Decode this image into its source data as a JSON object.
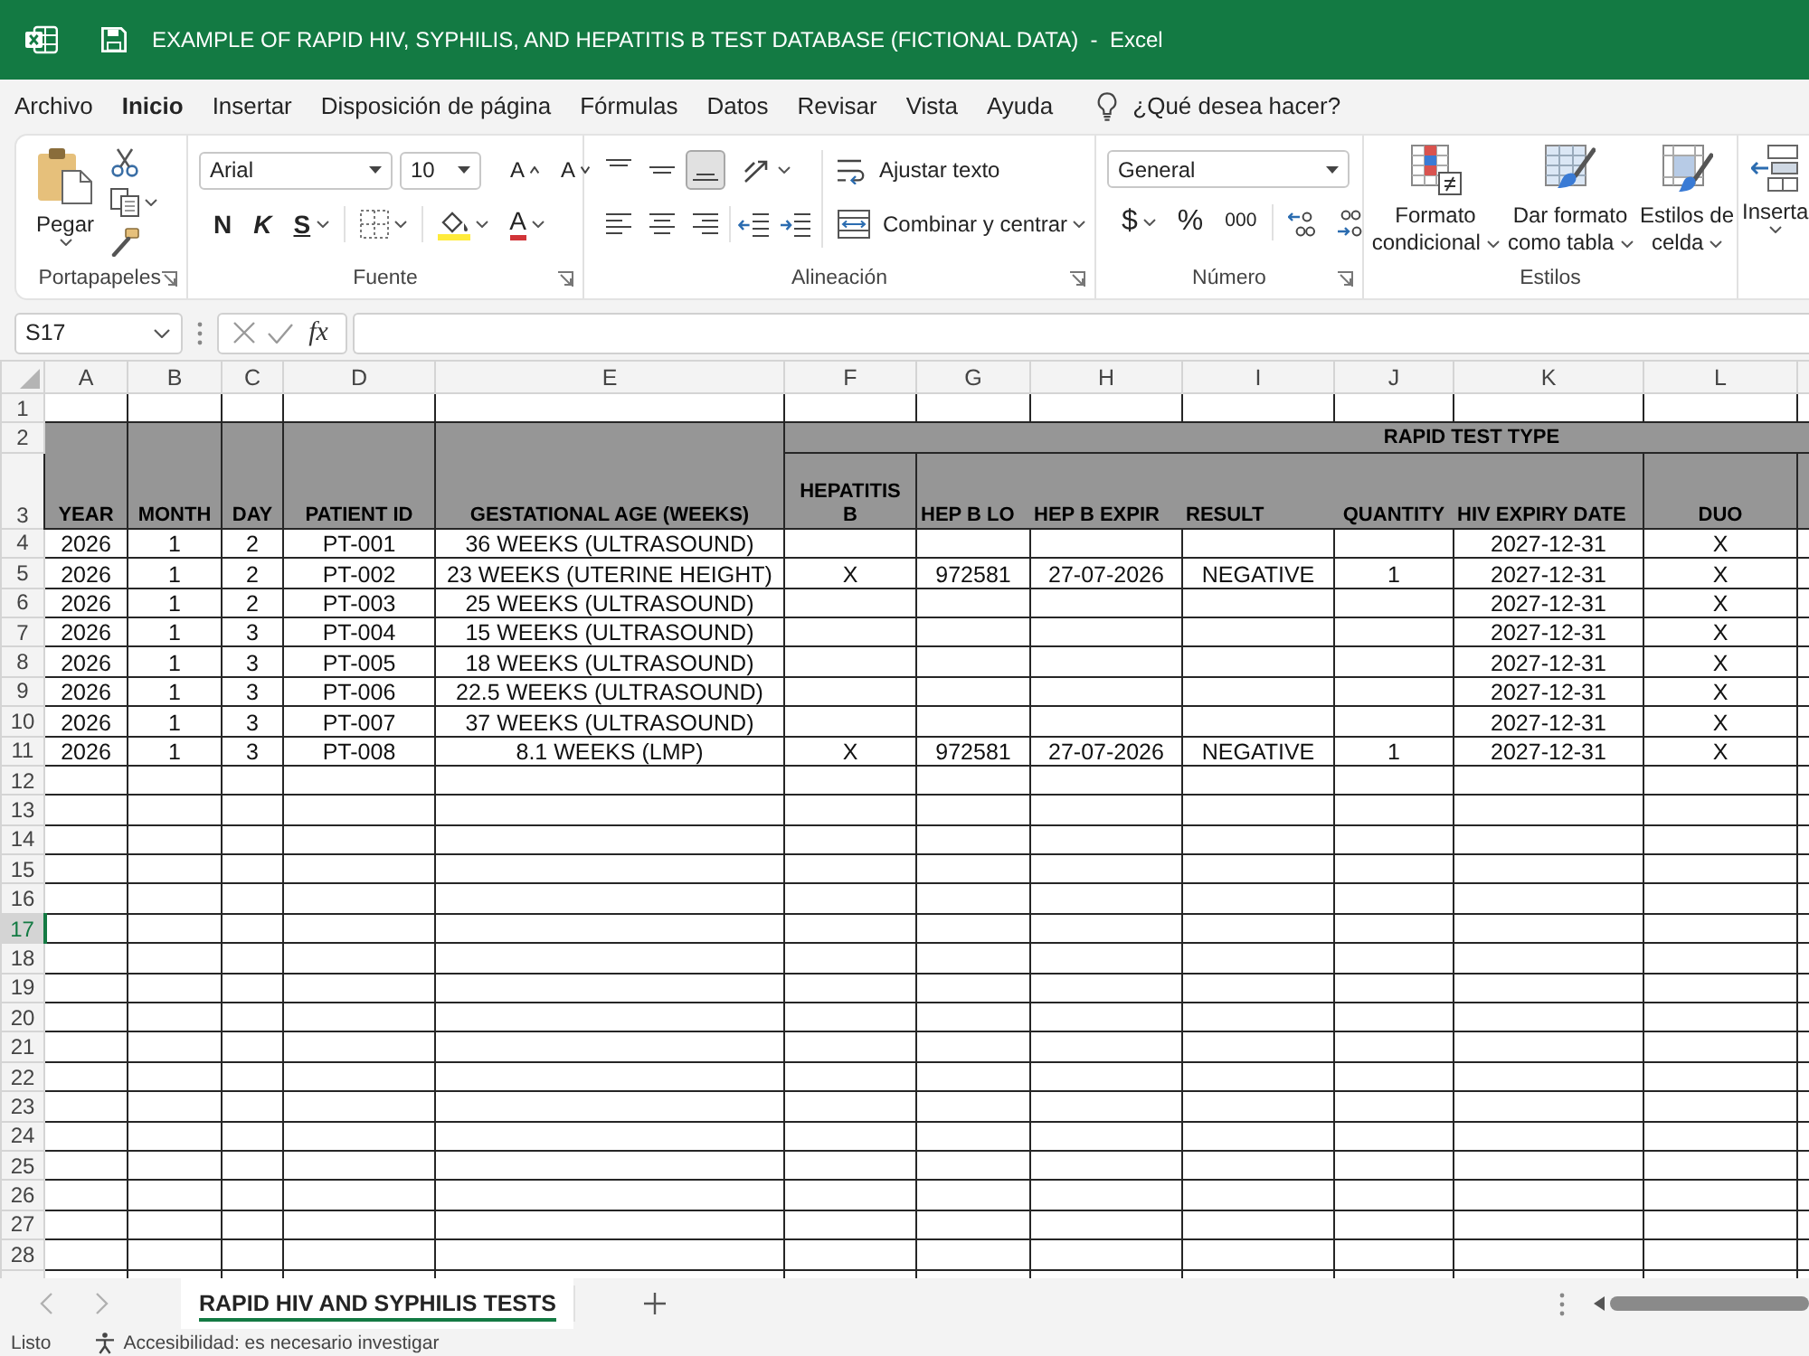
{
  "window": {
    "title": "EXAMPLE OF RAPID HIV, SYPHILIS, AND HEPATITIS B TEST DATABASE (FICTIONAL DATA)  -  Excel"
  },
  "ribbon_tabs": [
    {
      "label": "Archivo",
      "selected": false
    },
    {
      "label": "Inicio",
      "selected": true
    },
    {
      "label": "Insertar",
      "selected": false
    },
    {
      "label": "Disposición de página",
      "selected": false
    },
    {
      "label": "Fórmulas",
      "selected": false
    },
    {
      "label": "Datos",
      "selected": false
    },
    {
      "label": "Revisar",
      "selected": false
    },
    {
      "label": "Vista",
      "selected": false
    },
    {
      "label": "Ayuda",
      "selected": false
    }
  ],
  "tell_me": {
    "label": "¿Qué desea hacer?"
  },
  "ribbon": {
    "groups": [
      {
        "kind": "clipboard",
        "label": "Portapapeles",
        "paste": "Pegar"
      },
      {
        "kind": "font",
        "label": "Fuente",
        "font_name": "Arial",
        "font_size": "10",
        "grow": "A",
        "shrink": "A",
        "bold": "N",
        "italic": "K",
        "underline": "S",
        "font_color": "A"
      },
      {
        "kind": "alignment",
        "label": "Alineación",
        "vertical": [
          {
            "kind": "top",
            "selected": false
          },
          {
            "kind": "middle",
            "selected": false
          },
          {
            "kind": "bottom",
            "selected": true
          }
        ],
        "horizontal": [
          {
            "kind": "left",
            "selected": false
          },
          {
            "kind": "center",
            "selected": false
          },
          {
            "kind": "right",
            "selected": false
          }
        ],
        "wrap_text": "Ajustar texto",
        "merge": "Combinar y centrar"
      },
      {
        "kind": "number",
        "label": "Número",
        "format": "General",
        "currency": "$",
        "percent": "%",
        "thousands": "000"
      },
      {
        "kind": "styles",
        "label": "Estilos",
        "buttons": [
          "Formato condicional",
          "Dar formato como tabla",
          "Estilos de celda"
        ]
      },
      {
        "kind": "cells",
        "insert": "Inserta"
      }
    ]
  },
  "formula_bar": {
    "name_box": "S17",
    "function_label": "fx"
  },
  "sheet": {
    "columns": [
      "A",
      "B",
      "C",
      "D",
      "E",
      "F",
      "G",
      "H",
      "I",
      "J",
      "K",
      "L"
    ],
    "rows": [
      {
        "number": "1",
        "selected": false,
        "kind": "blank"
      },
      {
        "number": "2",
        "selected": false,
        "kind": "group",
        "title": "RAPID TEST TYPE"
      },
      {
        "number": "3",
        "selected": false,
        "kind": "titles",
        "cells": {
          "A": "YEAR",
          "B": "MONTH",
          "C": "DAY",
          "D": "PATIENT ID",
          "E": "GESTATIONAL AGE (WEEKS)",
          "F": "HEPATITIS B",
          "G": "HEP B LO",
          "H": "HEP B EXPIR",
          "I": "RESULT",
          "J": "QUANTITY",
          "K": "HIV EXPIRY DATE",
          "L": "DUO"
        }
      },
      {
        "number": "4",
        "selected": false,
        "kind": "data",
        "cells": {
          "A": "2026",
          "B": "1",
          "C": "2",
          "D": "PT-001",
          "E": "36 WEEKS (ULTRASOUND)",
          "K": "2027-12-31",
          "L": "X"
        }
      },
      {
        "number": "5",
        "selected": false,
        "kind": "data",
        "cells": {
          "A": "2026",
          "B": "1",
          "C": "2",
          "D": "PT-002",
          "E": "23 WEEKS (UTERINE HEIGHT)",
          "F": "X",
          "G": "972581",
          "H": "27-07-2026",
          "I": "NEGATIVE",
          "J": "1",
          "K": "2027-12-31",
          "L": "X"
        }
      },
      {
        "number": "6",
        "selected": false,
        "kind": "data",
        "cells": {
          "A": "2026",
          "B": "1",
          "C": "2",
          "D": "PT-003",
          "E": "25 WEEKS (ULTRASOUND)",
          "K": "2027-12-31",
          "L": "X"
        }
      },
      {
        "number": "7",
        "selected": false,
        "kind": "data",
        "cells": {
          "A": "2026",
          "B": "1",
          "C": "3",
          "D": "PT-004",
          "E": "15 WEEKS (ULTRASOUND)",
          "K": "2027-12-31",
          "L": "X"
        }
      },
      {
        "number": "8",
        "selected": false,
        "kind": "data",
        "cells": {
          "A": "2026",
          "B": "1",
          "C": "3",
          "D": "PT-005",
          "E": "18 WEEKS (ULTRASOUND)",
          "K": "2027-12-31",
          "L": "X"
        }
      },
      {
        "number": "9",
        "selected": false,
        "kind": "data",
        "cells": {
          "A": "2026",
          "B": "1",
          "C": "3",
          "D": "PT-006",
          "E": "22.5 WEEKS (ULTRASOUND)",
          "K": "2027-12-31",
          "L": "X"
        }
      },
      {
        "number": "10",
        "selected": false,
        "kind": "data",
        "cells": {
          "A": "2026",
          "B": "1",
          "C": "3",
          "D": "PT-007",
          "E": "37 WEEKS (ULTRASOUND)",
          "K": "2027-12-31",
          "L": "X"
        }
      },
      {
        "number": "11",
        "selected": false,
        "kind": "data",
        "cells": {
          "A": "2026",
          "B": "1",
          "C": "3",
          "D": "PT-008",
          "E": "8.1 WEEKS (LMP)",
          "F": "X",
          "G": "972581",
          "H": "27-07-2026",
          "I": "NEGATIVE",
          "J": "1",
          "K": "2027-12-31",
          "L": "X"
        }
      },
      {
        "number": "12",
        "selected": false,
        "kind": "blank"
      },
      {
        "number": "13",
        "selected": false,
        "kind": "blank"
      },
      {
        "number": "14",
        "selected": false,
        "kind": "blank"
      },
      {
        "number": "15",
        "selected": false,
        "kind": "blank"
      },
      {
        "number": "16",
        "selected": false,
        "kind": "blank"
      },
      {
        "number": "17",
        "selected": true,
        "kind": "blank"
      },
      {
        "number": "18",
        "selected": false,
        "kind": "blank"
      },
      {
        "number": "19",
        "selected": false,
        "kind": "blank"
      },
      {
        "number": "20",
        "selected": false,
        "kind": "blank"
      },
      {
        "number": "21",
        "selected": false,
        "kind": "blank"
      },
      {
        "number": "22",
        "selected": false,
        "kind": "blank"
      },
      {
        "number": "23",
        "selected": false,
        "kind": "blank"
      },
      {
        "number": "24",
        "selected": false,
        "kind": "blank"
      },
      {
        "number": "25",
        "selected": false,
        "kind": "blank"
      },
      {
        "number": "26",
        "selected": false,
        "kind": "blank"
      },
      {
        "number": "27",
        "selected": false,
        "kind": "blank"
      },
      {
        "number": "28",
        "selected": false,
        "kind": "blank"
      }
    ]
  },
  "sheet_tabs": [
    {
      "label": "RAPID HIV AND SYPHILIS TESTS",
      "selected": true
    }
  ],
  "status_bar": {
    "mode": "Listo",
    "accessibility": "Accesibilidad: es necesario investigar"
  }
}
